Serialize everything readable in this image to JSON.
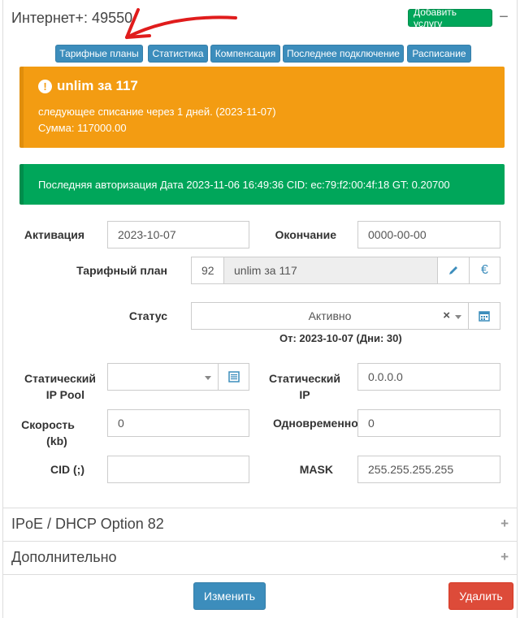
{
  "header": {
    "title": "Интернет+: 49550",
    "add_service_label": "Добавить услугу",
    "collapse_icon": "minus-icon"
  },
  "tabs": [
    {
      "label": "Тарифные планы"
    },
    {
      "label": "Статистика"
    },
    {
      "label": "Компенсация"
    },
    {
      "label": "Последнее подключение"
    },
    {
      "label": "Расписание"
    }
  ],
  "warning_alert": {
    "icon": "exclamation-circle-icon",
    "title": "unlim за 117",
    "line1": "следующее списание через 1 дней. (2023-11-07)",
    "line2": "Сумма: 117000.00"
  },
  "success_alert": {
    "text": "Последняя авторизация Дата 2023-11-06 16:49:36 CID: ec:79:f2:00:4f:18 GT: 0.20700"
  },
  "form": {
    "activation_label": "Активация",
    "activation_value": "2023-10-07",
    "end_label": "Окончание",
    "end_value": "0000-00-00",
    "tariff_label": "Тарифный план",
    "tariff_id": "92",
    "tariff_name": "unlim за 117",
    "status_label": "Статус",
    "status_value": "Активно",
    "status_clear": "×",
    "status_since": "От: 2023-10-07 (Дни: 30)",
    "static_ip_pool_label_1": "Статический",
    "static_ip_pool_label_2": "IP Pool",
    "static_ip_label_1": "Статический",
    "static_ip_label_2": "IP",
    "static_ip_value": "0.0.0.0",
    "speed_label_1": "Скорость",
    "speed_label_2": "(kb)",
    "speed_value": "0",
    "simultaneous_label": "Одновременно",
    "simultaneous_value": "0",
    "cid_label": "CID (;)",
    "cid_value": "",
    "mask_label": "MASK",
    "mask_value": "255.255.255.255"
  },
  "sections": [
    {
      "label": "IPoE / DHCP Option 82"
    },
    {
      "label": "Дополнительно"
    }
  ],
  "footer": {
    "edit_label": "Изменить",
    "delete_label": "Удалить"
  },
  "colors": {
    "primary": "#3c8dbc",
    "success": "#00a65a",
    "warning": "#f39c12",
    "danger": "#dd4b39",
    "annotation_arrow": "#e01c1c"
  }
}
